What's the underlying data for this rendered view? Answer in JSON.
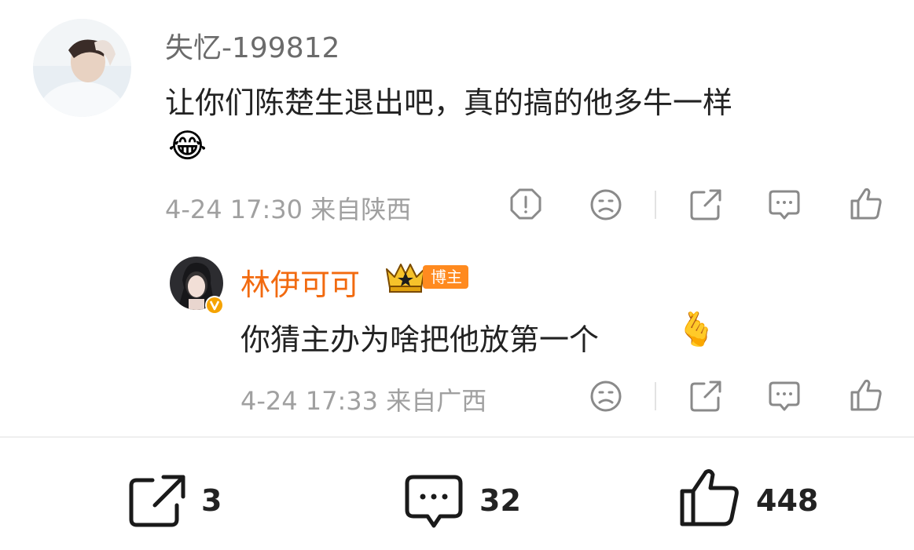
{
  "comment": {
    "username": "失忆-199812",
    "text": "让你们陈楚生退出吧，真的搞的他多牛一样",
    "emoji": "😂",
    "meta": "4-24 17:30 来自陕西",
    "actions": [
      "report-icon",
      "dislike-icon",
      "share-icon",
      "comment-icon",
      "like-icon"
    ]
  },
  "reply": {
    "username": "林伊可可",
    "badge": "博主",
    "text": "你猜主办为啥把他放第一个",
    "emoji": "🫰",
    "meta": "4-24 17:33 来自广西",
    "actions": [
      "dislike-icon",
      "share-icon",
      "comment-icon",
      "like-icon"
    ]
  },
  "bottom_bar": {
    "share_count": "3",
    "comment_count": "32",
    "like_count": "448"
  },
  "colors": {
    "accent": "#f26a0f",
    "badge": "#ff8a1f",
    "muted": "#9a9a9a",
    "text": "#222222"
  }
}
